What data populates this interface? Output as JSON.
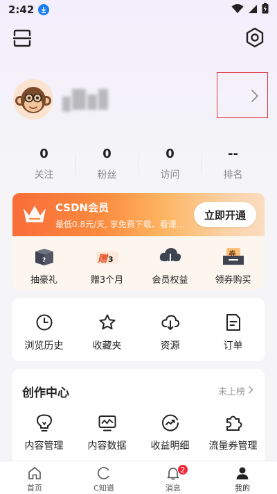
{
  "status_bar": {
    "time": "2:42"
  },
  "profile": {
    "name_hidden": true
  },
  "stats": [
    {
      "value": "0",
      "label": "关注"
    },
    {
      "value": "0",
      "label": "粉丝"
    },
    {
      "value": "0",
      "label": "访问"
    },
    {
      "value": "--",
      "label": "排名"
    }
  ],
  "vip": {
    "title": "CSDN会员",
    "desc": "最低0.8元/天, 享免费下载、看课…",
    "open_button": "立即开通",
    "items": [
      {
        "label": "抽豪礼",
        "icon": "mystery-box-icon"
      },
      {
        "label": "赠3个月",
        "icon": "gift-text-icon"
      },
      {
        "label": "会员权益",
        "icon": "cloud-download-icon"
      },
      {
        "label": "领券购买",
        "icon": "coupon-icon"
      }
    ]
  },
  "quick": [
    {
      "label": "浏览历史",
      "icon": "clock-icon"
    },
    {
      "label": "收藏夹",
      "icon": "star-icon"
    },
    {
      "label": "资源",
      "icon": "cloud-download-icon"
    },
    {
      "label": "订单",
      "icon": "document-icon"
    }
  ],
  "create": {
    "title": "创作中心",
    "rank_link": "未上榜",
    "items": [
      {
        "label": "内容管理",
        "icon": "lightbulb-icon"
      },
      {
        "label": "内容数据",
        "icon": "chart-monitor-icon"
      },
      {
        "label": "收益明细",
        "icon": "income-icon"
      },
      {
        "label": "流量券管理",
        "icon": "puzzle-icon"
      }
    ]
  },
  "tabs": [
    {
      "label": "首页",
      "icon": "home-icon"
    },
    {
      "label": "C知道",
      "icon": "c-logo-icon"
    },
    {
      "label": "消息",
      "icon": "bell-icon",
      "badge": "2"
    },
    {
      "label": "我的",
      "icon": "person-icon"
    }
  ],
  "colors": {
    "accent_red": "#e0313a",
    "vip_orange": "#f96d39",
    "badge_red": "#f0283a"
  }
}
